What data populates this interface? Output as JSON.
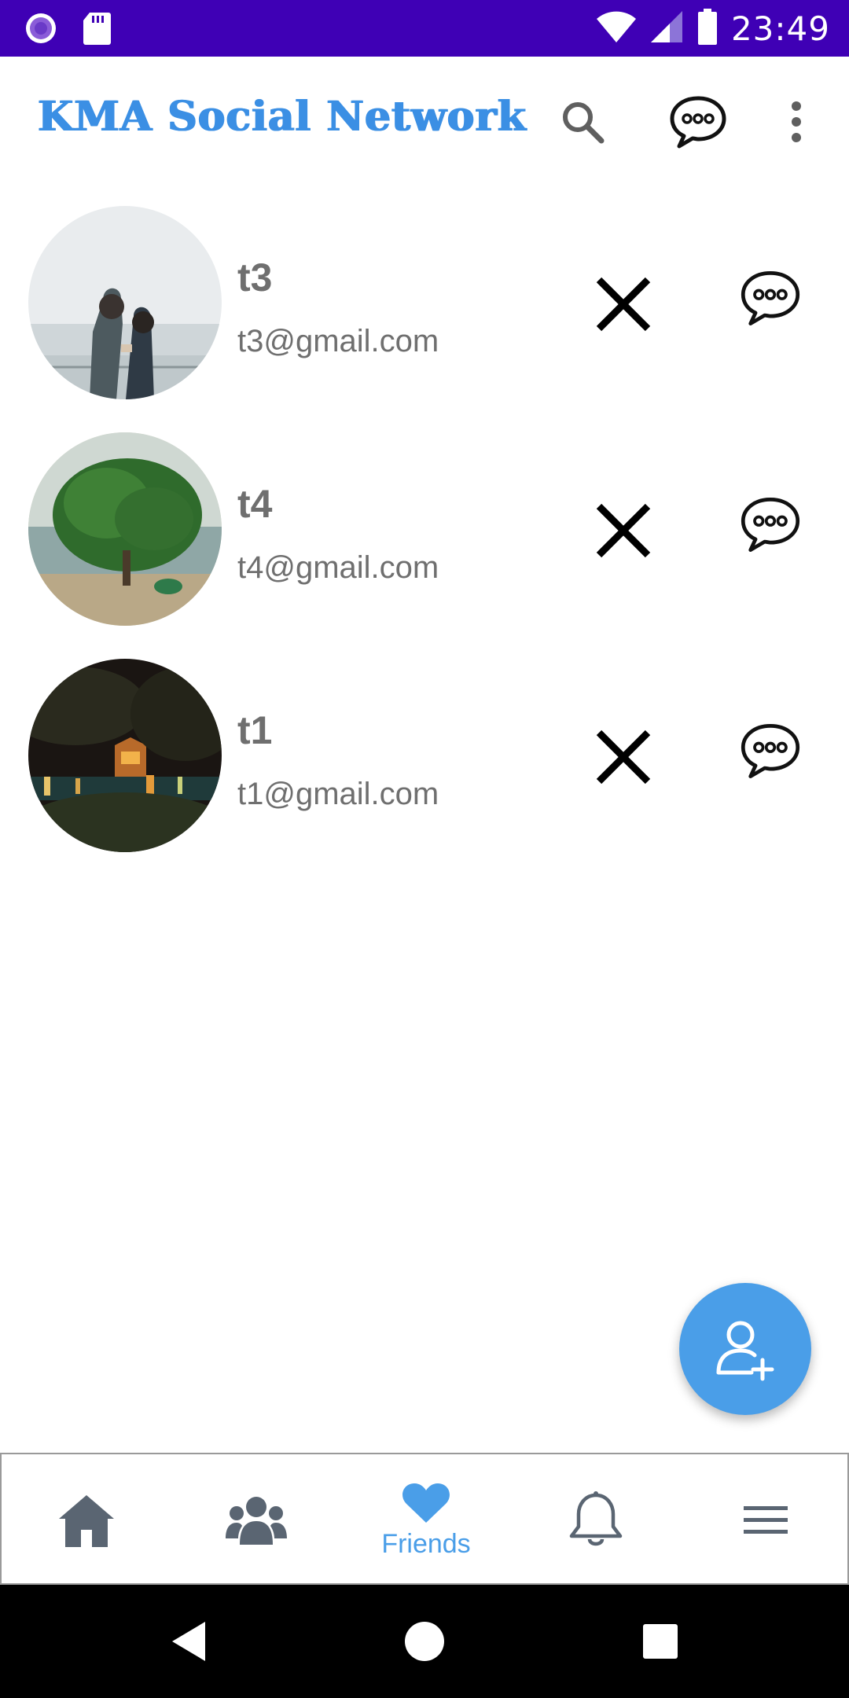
{
  "status_bar": {
    "time": "23:49",
    "background": "#3f00b5"
  },
  "app_bar": {
    "title": "KMA Social Network",
    "title_color": "#3b8fe4",
    "icons": [
      "search-icon",
      "chat-bubble-icon",
      "overflow-menu-icon"
    ]
  },
  "friends": [
    {
      "name": "t3",
      "email": "t3@gmail.com",
      "avatar": "couple-by-lake-photo"
    },
    {
      "name": "t4",
      "email": "t4@gmail.com",
      "avatar": "tree-by-lake-photo"
    },
    {
      "name": "t1",
      "email": "t1@gmail.com",
      "avatar": "night-lake-temple-photo"
    }
  ],
  "row_actions": [
    "close-icon",
    "chat-bubble-icon"
  ],
  "fab": {
    "icon": "add-user-icon",
    "color": "#4a9ee8"
  },
  "bottom_nav": {
    "items": [
      {
        "icon": "home-icon",
        "label": ""
      },
      {
        "icon": "groups-icon",
        "label": ""
      },
      {
        "icon": "heart-icon",
        "label": "Friends",
        "active": true
      },
      {
        "icon": "bell-icon",
        "label": ""
      },
      {
        "icon": "hamburger-menu-icon",
        "label": ""
      }
    ],
    "active_color": "#4a9ee8",
    "inactive_color": "#5a6572"
  },
  "system_nav": [
    "back-icon",
    "home-circle-icon",
    "recents-icon"
  ]
}
